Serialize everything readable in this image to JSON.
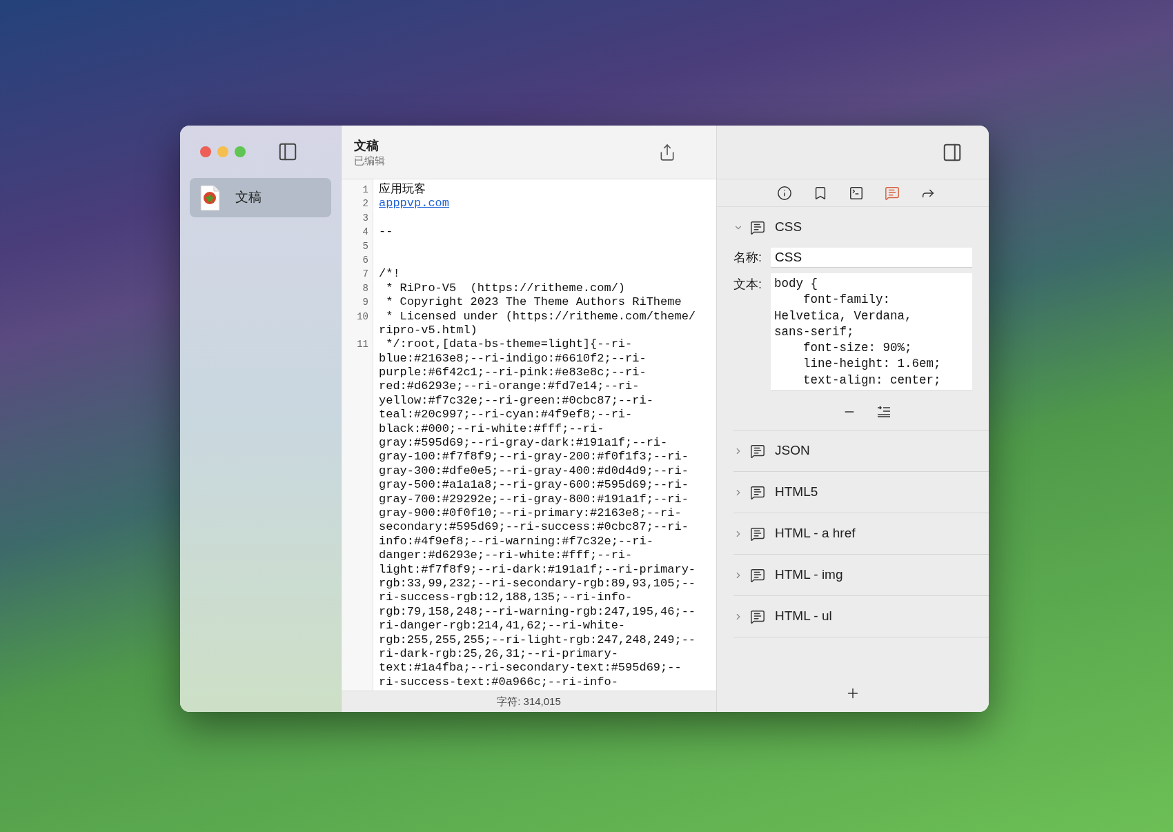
{
  "sidebar": {
    "items": [
      {
        "label": "文稿",
        "selected": true
      }
    ]
  },
  "document": {
    "title": "文稿",
    "subtitle": "已编辑"
  },
  "editor": {
    "lines": [
      {
        "number": "1",
        "kind": "text",
        "rows": [
          "应用玩客"
        ]
      },
      {
        "number": "2",
        "kind": "link",
        "rows": [
          "apppvp.com"
        ]
      },
      {
        "number": "3",
        "kind": "text",
        "rows": [
          ""
        ]
      },
      {
        "number": "4",
        "kind": "text",
        "rows": [
          "--"
        ]
      },
      {
        "number": "5",
        "kind": "text",
        "rows": [
          ""
        ]
      },
      {
        "number": "6",
        "kind": "text",
        "rows": [
          ""
        ]
      },
      {
        "number": "7",
        "kind": "text",
        "rows": [
          "/*!"
        ]
      },
      {
        "number": "8",
        "kind": "text",
        "rows": [
          " * RiPro-V5  (https://ritheme.com/)"
        ]
      },
      {
        "number": "9",
        "kind": "text",
        "rows": [
          " * Copyright 2023 The Theme Authors RiTheme"
        ]
      },
      {
        "number": "10",
        "kind": "text",
        "rows": [
          " * Licensed under (https://ritheme.com/theme/",
          "ripro-v5.html)"
        ]
      },
      {
        "number": "11",
        "kind": "text",
        "rows": [
          " */:root,[data-bs-theme=light]{--ri-",
          "blue:#2163e8;--ri-indigo:#6610f2;--ri-",
          "purple:#6f42c1;--ri-pink:#e83e8c;--ri-",
          "red:#d6293e;--ri-orange:#fd7e14;--ri-",
          "yellow:#f7c32e;--ri-green:#0cbc87;--ri-",
          "teal:#20c997;--ri-cyan:#4f9ef8;--ri-",
          "black:#000;--ri-white:#fff;--ri-",
          "gray:#595d69;--ri-gray-dark:#191a1f;--ri-",
          "gray-100:#f7f8f9;--ri-gray-200:#f0f1f3;--ri-",
          "gray-300:#dfe0e5;--ri-gray-400:#d0d4d9;--ri-",
          "gray-500:#a1a1a8;--ri-gray-600:#595d69;--ri-",
          "gray-700:#29292e;--ri-gray-800:#191a1f;--ri-",
          "gray-900:#0f0f10;--ri-primary:#2163e8;--ri-",
          "secondary:#595d69;--ri-success:#0cbc87;--ri-",
          "info:#4f9ef8;--ri-warning:#f7c32e;--ri-",
          "danger:#d6293e;--ri-white:#fff;--ri-",
          "light:#f7f8f9;--ri-dark:#191a1f;--ri-primary-",
          "rgb:33,99,232;--ri-secondary-rgb:89,93,105;--",
          "ri-success-rgb:12,188,135;--ri-info-",
          "rgb:79,158,248;--ri-warning-rgb:247,195,46;--",
          "ri-danger-rgb:214,41,62;--ri-white-",
          "rgb:255,255,255;--ri-light-rgb:247,248,249;--",
          "ri-dark-rgb:25,26,31;--ri-primary-",
          "text:#1a4fba;--ri-secondary-text:#595d69;--",
          "ri-success-text:#0a966c;--ri-info-"
        ]
      }
    ]
  },
  "status_bar": {
    "char_count": "字符: 314,015"
  },
  "inspector": {
    "tabs": [
      {
        "kind": "info",
        "selected": false
      },
      {
        "kind": "bookmark",
        "selected": false
      },
      {
        "kind": "terminal",
        "selected": false
      },
      {
        "kind": "snippets",
        "selected": true
      },
      {
        "kind": "share",
        "selected": false
      }
    ],
    "snippets": [
      {
        "title": "CSS",
        "expanded": true,
        "name_label": "名称:",
        "name": "CSS",
        "text_label": "文本:",
        "text": "body {\n    font-family: Helvetica, Verdana, sans-serif;\n    font-size: 90%;\n    line-height: 1.6em;\n    text-align: center;"
      },
      {
        "title": "JSON",
        "expanded": false
      },
      {
        "title": "HTML5",
        "expanded": false
      },
      {
        "title": "HTML - a href",
        "expanded": false
      },
      {
        "title": "HTML - img",
        "expanded": false
      },
      {
        "title": "HTML - ul",
        "expanded": false
      }
    ]
  }
}
